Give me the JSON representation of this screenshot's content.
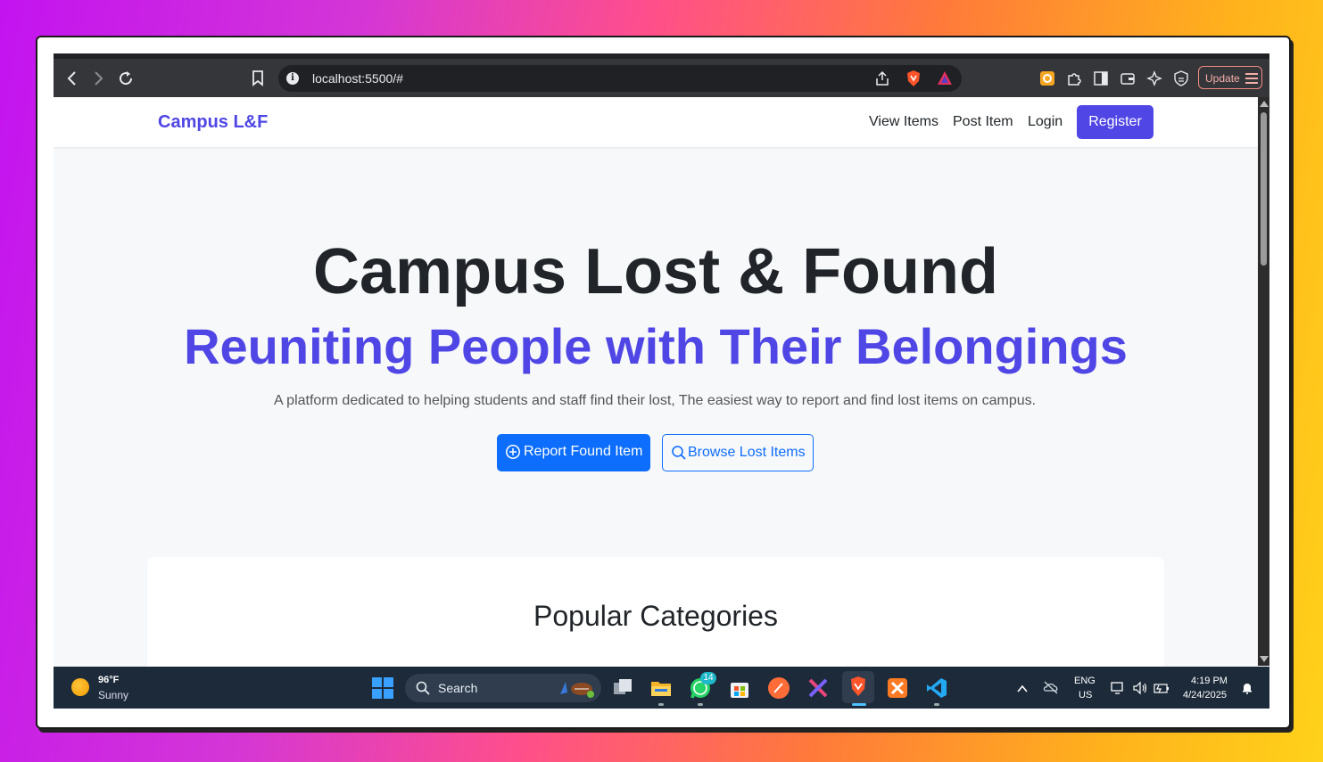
{
  "browser": {
    "url": "localhost:5500/#",
    "update_label": "Update"
  },
  "site": {
    "brand": "Campus L&F",
    "nav": {
      "view_items": "View Items",
      "post_item": "Post Item",
      "login": "Login",
      "register": "Register"
    },
    "hero": {
      "title": "Campus Lost & Found",
      "subtitle": "Reuniting People with Their Belongings",
      "description": "A platform dedicated to helping students and staff find their lost, The easiest way to report and find lost items on campus.",
      "report_button": "Report Found Item",
      "browse_button": "Browse Lost Items"
    },
    "categories_title": "Popular Categories"
  },
  "taskbar": {
    "weather_temp": "96°F",
    "weather_cond": "Sunny",
    "search_label": "Search",
    "whatsapp_badge": "14",
    "lang_top": "ENG",
    "lang_bottom": "US",
    "time": "4:19 PM",
    "date": "4/24/2025"
  },
  "colors": {
    "brand": "#4f46e5",
    "primary": "#0d6efd"
  }
}
